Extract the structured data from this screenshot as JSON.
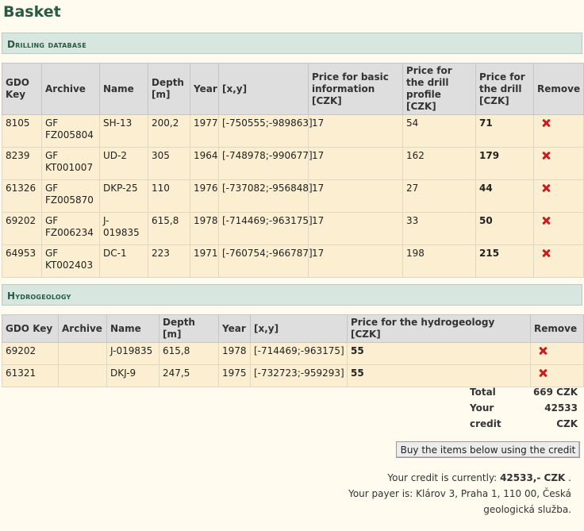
{
  "page": {
    "title": "Basket"
  },
  "drilling": {
    "section_title": "Drilling database",
    "headers": [
      "GDO Key",
      "Archive",
      "Name",
      "Depth [m]",
      "Year",
      "[x,y]",
      "Price for basic information [CZK]",
      "Price for the drill profile [CZK]",
      "Price for the drill [CZK]",
      "Remove"
    ],
    "rows": [
      [
        "8105",
        "GF FZ005804",
        "SH-13",
        "200,2",
        "1977",
        "[-750555;-989863]",
        "17",
        "54",
        "71"
      ],
      [
        "8239",
        "GF KT001007",
        "UD-2",
        "305",
        "1964",
        "[-748978;-990677]",
        "17",
        "162",
        "179"
      ],
      [
        "61326",
        "GF FZ005870",
        "DKP-25",
        "110",
        "1976",
        "[-737082;-956848]",
        "17",
        "27",
        "44"
      ],
      [
        "69202",
        "GF FZ006234",
        "J-019835",
        "615,8",
        "1978",
        "[-714469;-963175]",
        "17",
        "33",
        "50"
      ],
      [
        "64953",
        "GF KT002403",
        "DC-1",
        "223",
        "1971",
        "[-760754;-966787]",
        "17",
        "198",
        "215"
      ]
    ]
  },
  "hydro": {
    "section_title": "Hydrogeology",
    "headers": [
      "GDO Key",
      "Archive",
      "Name",
      "Depth [m]",
      "Year",
      "[x,y]",
      "Price for the hydrogeology [CZK]",
      "Remove"
    ],
    "rows": [
      [
        "69202",
        "",
        "J-019835",
        "615,8",
        "1978",
        "[-714469;-963175]",
        "55"
      ],
      [
        "61321",
        "",
        "DKJ-9",
        "247,5",
        "1975",
        "[-732723;-959293]",
        "55"
      ]
    ]
  },
  "totals": {
    "total_label": "Total",
    "total_value": "669 CZK",
    "credit_label": "Your credit",
    "credit_value": "42533 CZK"
  },
  "buy_button": "Buy the items below using the credit",
  "credit_info": {
    "prefix": "Your credit is currently:",
    "amount": "42533,- CZK",
    "suffix": ".",
    "payer_prefix": "Your payer is:",
    "payer_line1": "Klárov 3, Praha 1, 110 00, Česká",
    "payer_line2": "geologická služba."
  },
  "colors": {
    "title": "#2a5a44",
    "section_bar": "#d8e6e0",
    "header_bg": "#dedede",
    "row_bg": "#fcefd1",
    "remove_icon": "#c81d1d"
  },
  "icons": {
    "remove": "remove-x-icon"
  }
}
